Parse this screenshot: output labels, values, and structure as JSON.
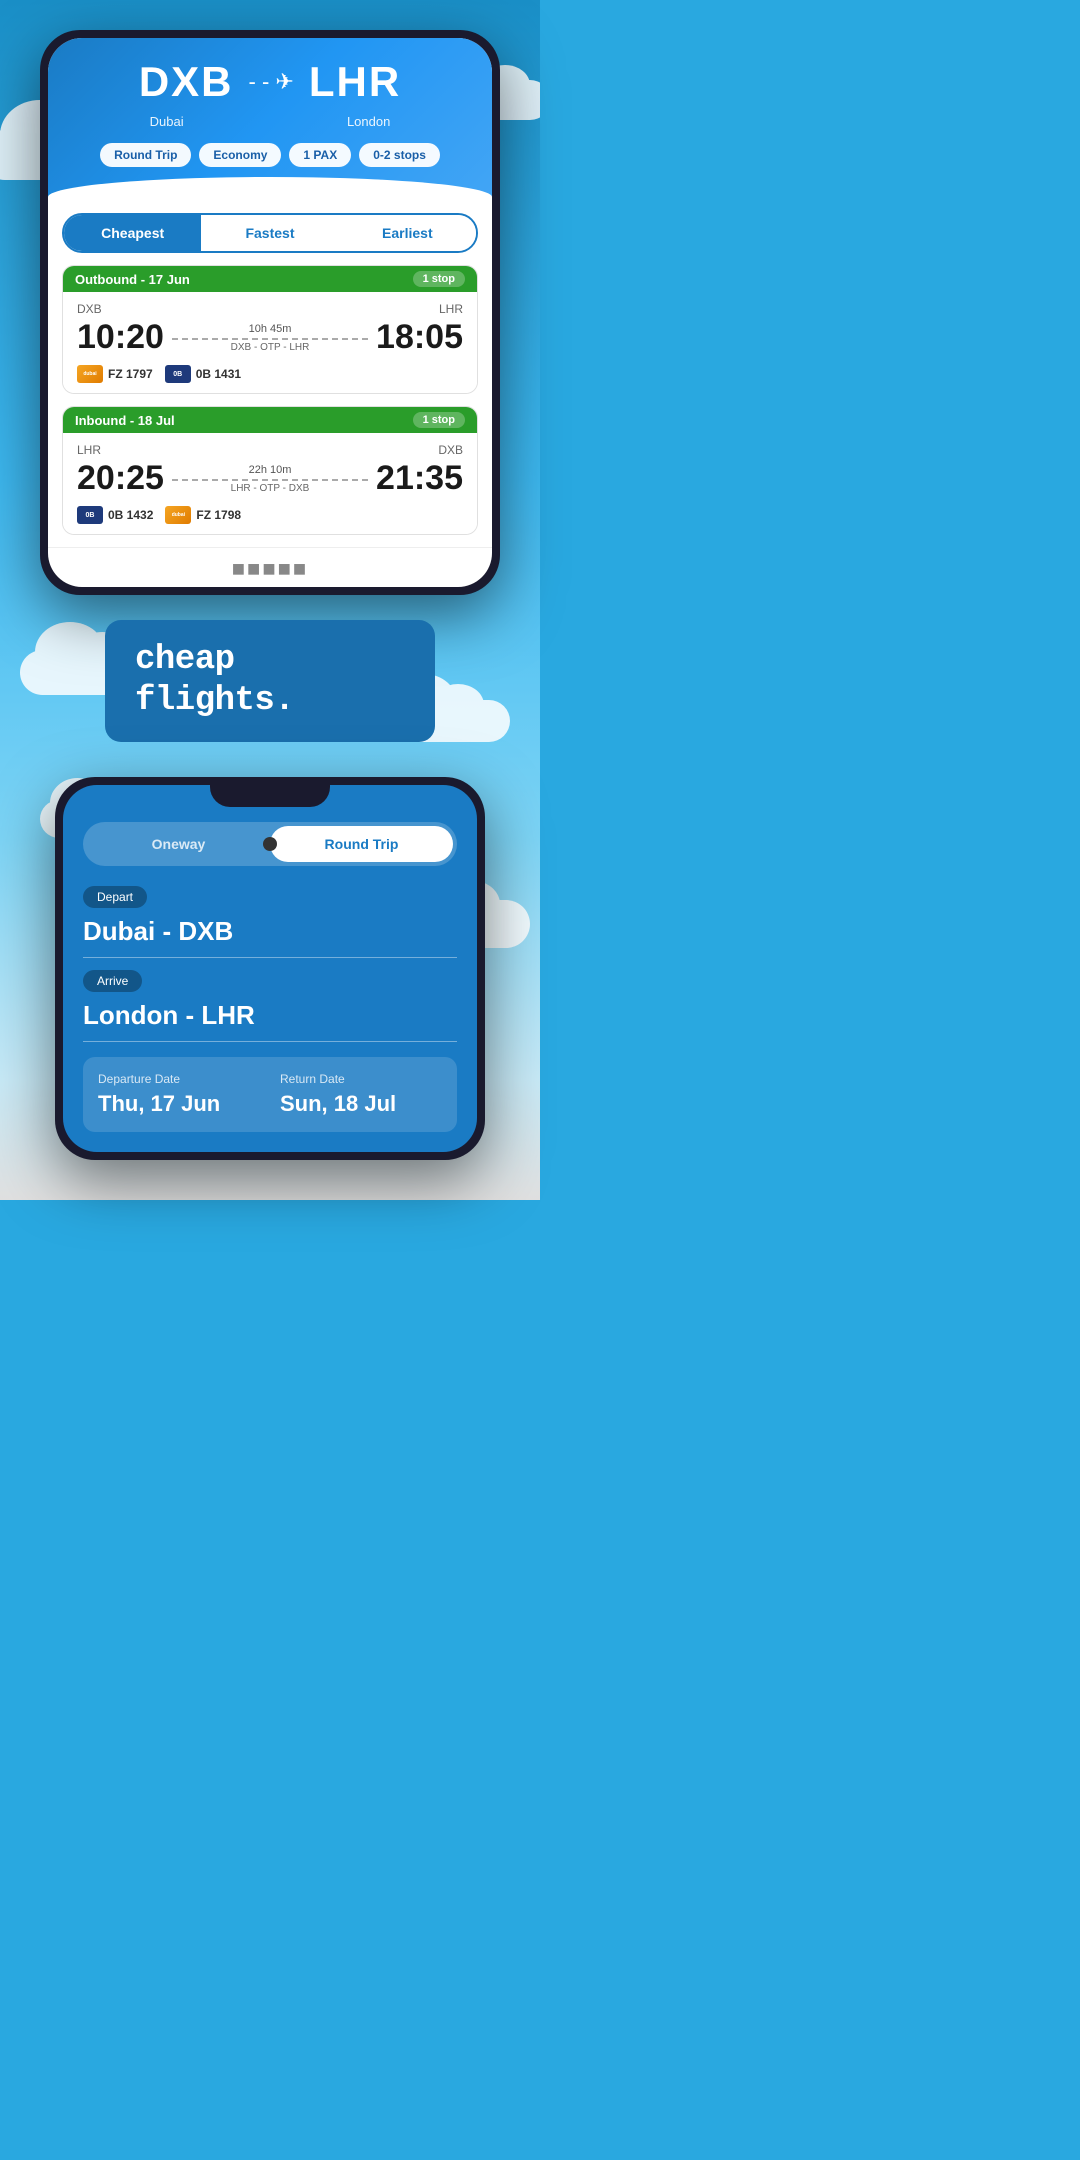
{
  "phone1": {
    "from_code": "DXB",
    "from_city": "Dubai",
    "to_code": "LHR",
    "to_city": "London",
    "pills": [
      "Round Trip",
      "Economy",
      "1 PAX",
      "0-2 stops"
    ],
    "tabs": [
      "Cheapest",
      "Fastest",
      "Earliest"
    ],
    "active_tab": "Cheapest",
    "outbound": {
      "label": "Outbound - 17 Jun",
      "stop_badge": "1 stop",
      "from_code": "DXB",
      "to_code": "LHR",
      "depart_time": "10:20",
      "arrive_time": "18:05",
      "duration": "10h 45m",
      "route": "DXB - OTP - LHR",
      "airlines": [
        {
          "logo_class": "logo-dubai",
          "logo_text": "dubai",
          "flight": "FZ 1797"
        },
        {
          "logo_class": "logo-blue",
          "logo_text": "0B",
          "flight": "0B 1431"
        }
      ]
    },
    "inbound": {
      "label": "Inbound - 18 Jul",
      "stop_badge": "1 stop",
      "from_code": "LHR",
      "to_code": "DXB",
      "depart_time": "20:25",
      "arrive_time": "21:35",
      "duration": "22h 10m",
      "route": "LHR - OTP - DXB",
      "airlines": [
        {
          "logo_class": "logo-blue",
          "logo_text": "0B",
          "flight": "0B 1432"
        },
        {
          "logo_class": "logo-dubai",
          "logo_text": "dubai",
          "flight": "FZ 1798"
        }
      ]
    }
  },
  "tagline": {
    "line1": "cheap flights."
  },
  "phone2": {
    "toggle": {
      "oneway": "Oneway",
      "roundtrip": "Round Trip"
    },
    "depart_label": "Depart",
    "depart_value": "Dubai - DXB",
    "arrive_label": "Arrive",
    "arrive_value": "London - LHR",
    "departure_date_label": "Departure Date",
    "departure_date_value": "Thu, 17 Jun",
    "return_date_label": "Return Date",
    "return_date_value": "Sun, 18 Jul"
  }
}
